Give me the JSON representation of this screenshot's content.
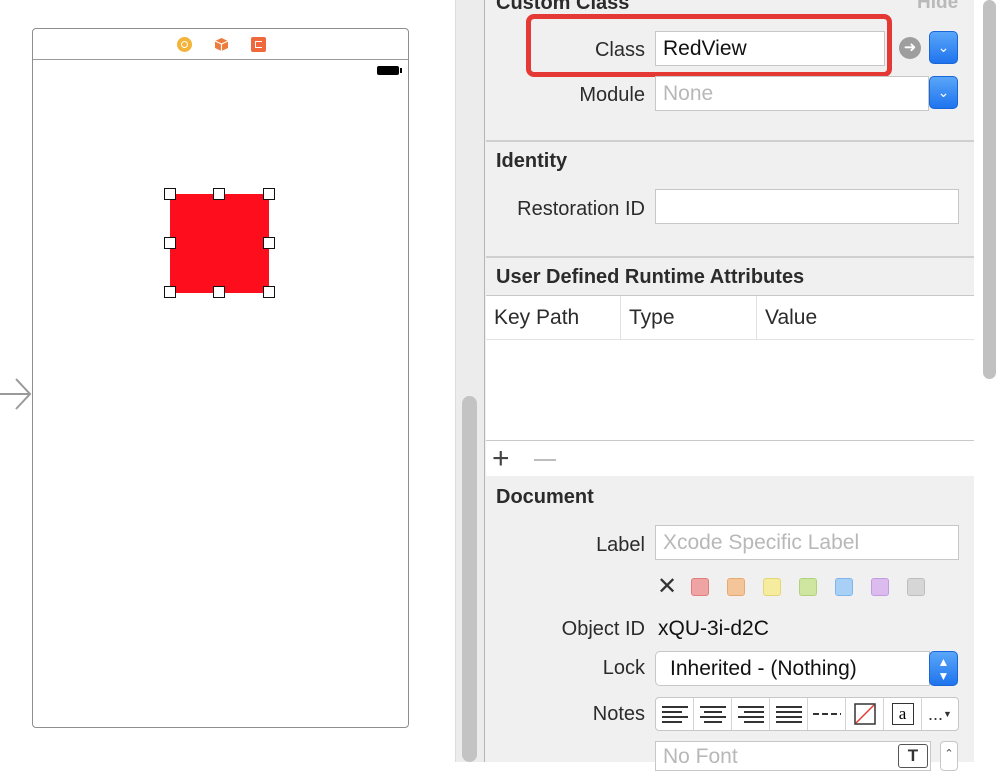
{
  "scene": {
    "icons": [
      "view-controller-icon",
      "first-responder-icon",
      "exit-icon"
    ],
    "selected_view_color": "#fe0e1d"
  },
  "inspector": {
    "custom_class": {
      "title": "Custom Class",
      "hide_label": "Hide",
      "class_label": "Class",
      "class_value": "RedView",
      "module_label": "Module",
      "module_placeholder": "None"
    },
    "identity": {
      "title": "Identity",
      "restoration_id_label": "Restoration ID",
      "restoration_id_value": ""
    },
    "runtime_attributes": {
      "title": "User Defined Runtime Attributes",
      "columns": [
        "Key Path",
        "Type",
        "Value"
      ],
      "add_symbol": "+",
      "rows": []
    },
    "document": {
      "title": "Document",
      "label_label": "Label",
      "label_placeholder": "Xcode Specific Label",
      "label_colors": [
        "#f0a3a3",
        "#f5c59a",
        "#f6ec9d",
        "#cfe6a1",
        "#a8d0f7",
        "#dcbcef",
        "#d6d6d6"
      ],
      "clear_symbol": "✕",
      "object_id_label": "Object ID",
      "object_id_value": "xQU-3i-d2C",
      "lock_label": "Lock",
      "lock_value": "Inherited - (Nothing)",
      "notes_label": "Notes",
      "more_symbol": "...",
      "font_placeholder": "No Font",
      "font_button": "T"
    }
  },
  "colors": {
    "accent_blue": "#1f74ee",
    "highlight_red": "#e53935"
  }
}
